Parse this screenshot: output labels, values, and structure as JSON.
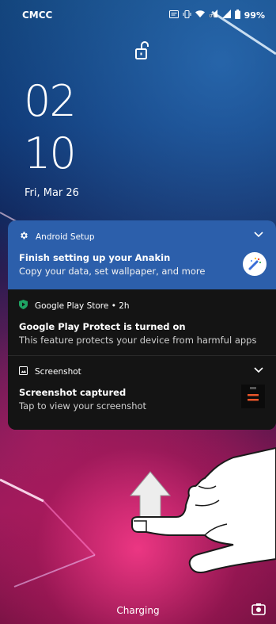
{
  "statusbar": {
    "carrier": "CMCC",
    "battery": "99%",
    "icons": [
      "notification-icon",
      "vibrate-icon",
      "wifi-icon",
      "lte-signal-icon",
      "signal-icon",
      "battery-icon"
    ]
  },
  "lockscreen": {
    "time_hour": "02",
    "time_minute": "10",
    "date": "Fri, Mar 26"
  },
  "notifications": [
    {
      "app": "Android Setup",
      "title": "Finish setting up your Anakin",
      "text": "Copy your data, set wallpaper, and more",
      "icon": "gear-icon",
      "accent": "#2c5fab"
    },
    {
      "app": "Google Play Store • 2h",
      "title": "Google Play Protect is turned on",
      "text": "This feature protects your device from harmful apps",
      "icon": "play-protect-icon",
      "accent": "#1fa463"
    },
    {
      "app": "Screenshot",
      "title": "Screenshot captured",
      "text": "Tap to view your screenshot",
      "icon": "screenshot-icon"
    }
  ],
  "footer": {
    "status": "Charging",
    "shortcut_icon": "camera-icon"
  }
}
